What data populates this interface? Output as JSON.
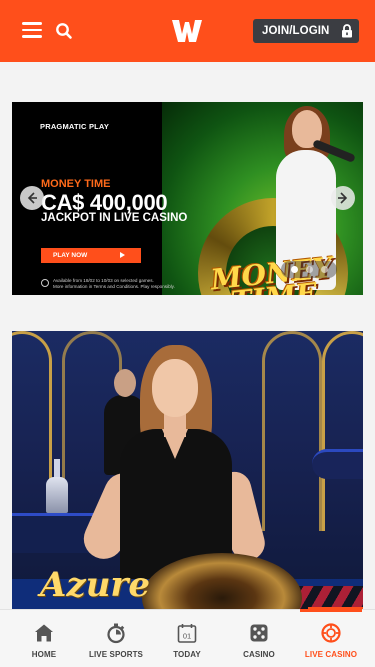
{
  "header": {
    "menu_icon": "hamburger-menu-icon",
    "search_icon": "search-icon",
    "logo_icon": "brand-w-logo",
    "join_label": "JOIN/LOGIN",
    "lock_icon": "lock-icon",
    "accent_color": "#ff4f1b"
  },
  "hero_banner": {
    "provider": "PRAGMATIC PLAY",
    "line1": "MONEY TIME",
    "amount": "CA$ 400,000",
    "line3": "JACKPOT IN LIVE CASINO",
    "cta_label": "PLAY NOW",
    "fineprint_1": "Available from 18/02 to 10/03 on selected games.",
    "fineprint_2": "More information in Terms and Conditions. Play responsibly.",
    "game_logo_text": "MONEY TIME",
    "prev_icon": "arrow-left-icon",
    "next_icon": "arrow-right-icon",
    "slides_total": 3,
    "active_slide": 1
  },
  "game_card": {
    "title": "Azure"
  },
  "bottom_nav": {
    "items": [
      {
        "label": "HOME",
        "icon": "home-icon"
      },
      {
        "label": "LIVE SPORTS",
        "icon": "stopwatch-icon"
      },
      {
        "label": "TODAY",
        "icon": "calendar-icon",
        "date": "01"
      },
      {
        "label": "CASINO",
        "icon": "dice-icon"
      },
      {
        "label": "LIVE CASINO",
        "icon": "roulette-chip-icon",
        "active": true
      }
    ]
  }
}
